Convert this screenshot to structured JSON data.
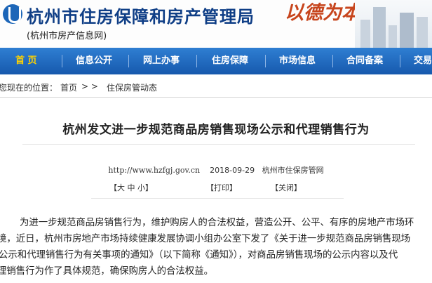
{
  "header": {
    "title": "杭州市住房保障和房产管理局",
    "subtitle": "(杭州市房产信息网)",
    "slogan": "以德为本"
  },
  "nav": {
    "items": [
      "首 页",
      "信息公开",
      "网上办事",
      "住房保障",
      "市场信息",
      "合同备案",
      "交易"
    ]
  },
  "breadcrumb": {
    "prefix": "您现在的位置：",
    "home": "首页",
    "sep": "> >",
    "current": "住保房管动态"
  },
  "article": {
    "title": "杭州发文进一步规范商品房销售现场公示和代理销售行为",
    "url": "http://www.hzfgj.gov.cn",
    "date": "2018-09-29",
    "source": "杭州市住保房管网",
    "font_size_label": "【大  中  小】",
    "print_label": "【打印】",
    "close_label": "【关闭】",
    "body_lines": [
      "为进一步规范商品房销售行为，维护购房人的合法权益，营造公开、公平、有序的房地产市场环",
      "境，近日，杭州市房地产市场持续健康发展协调小组办公室下发了《关于进一步规范商品房销售现场",
      "公示和代理销售行为有关事项的通知》（以下简称《通知》），对商品房销售现场的公示内容以及代",
      "理销售行为作了具体规范，确保购房人的合法权益。"
    ]
  }
}
